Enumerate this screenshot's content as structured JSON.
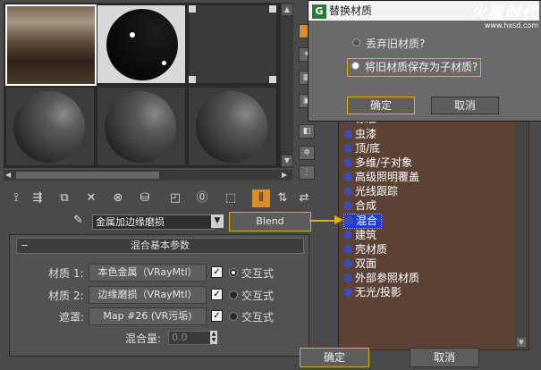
{
  "dialog": {
    "title": "替换材质",
    "option_discard": "丢弃旧材质?",
    "option_keep": "将旧材质保存为子材质?",
    "selected_option": "keep",
    "ok": "确定",
    "cancel": "取消"
  },
  "watermark": {
    "logo": "火星时代",
    "url": "www.hxsd.com"
  },
  "material": {
    "name": "金属加边缘磨损",
    "type_button": "Blend"
  },
  "rollout": {
    "title": "混合基本参数",
    "rows": [
      {
        "label": "材质 1:",
        "value": "本色金属（VRayMtl）",
        "checked": true,
        "radio_on": true,
        "interactive_label": "交互式"
      },
      {
        "label": "材质 2:",
        "value": "边缘磨损（VRayMtl）",
        "checked": true,
        "radio_on": false,
        "interactive_label": "交互式"
      },
      {
        "label": "遮罩:",
        "value": "Map #26 (VR污垢)",
        "checked": true,
        "radio_on": false,
        "interactive_label": "交互式"
      }
    ],
    "mix_label": "混合量:",
    "mix_value": "0.0"
  },
  "list": {
    "items": [
      {
        "label": "标准",
        "selected": false
      },
      {
        "label": "虫漆",
        "selected": false
      },
      {
        "label": "顶/底",
        "selected": false
      },
      {
        "label": "多维/子对象",
        "selected": false
      },
      {
        "label": "高级照明覆盖",
        "selected": false
      },
      {
        "label": "光线跟踪",
        "selected": false
      },
      {
        "label": "合成",
        "selected": false
      },
      {
        "label": "混合",
        "selected": true
      },
      {
        "label": "建筑",
        "selected": false
      },
      {
        "label": "壳材质",
        "selected": false
      },
      {
        "label": "双面",
        "selected": false
      },
      {
        "label": "外部参照材质",
        "selected": false
      },
      {
        "label": "无光/投影",
        "selected": false
      }
    ]
  },
  "buttons": {
    "ok": "确定",
    "cancel": "取消"
  },
  "icons": {
    "toolbar": [
      "get-material-icon",
      "put-to-scene-icon",
      "assign-icon",
      "reset-icon",
      "make-unique-icon",
      "put-to-library-icon",
      "material-id-icon",
      "show-map-icon",
      "show-end-icon",
      "go-parent-icon",
      "go-sibling-icon"
    ]
  },
  "colors": {
    "accent": "#e0b000",
    "list_bg": "#5b4234",
    "selection": "#1c40c9"
  }
}
